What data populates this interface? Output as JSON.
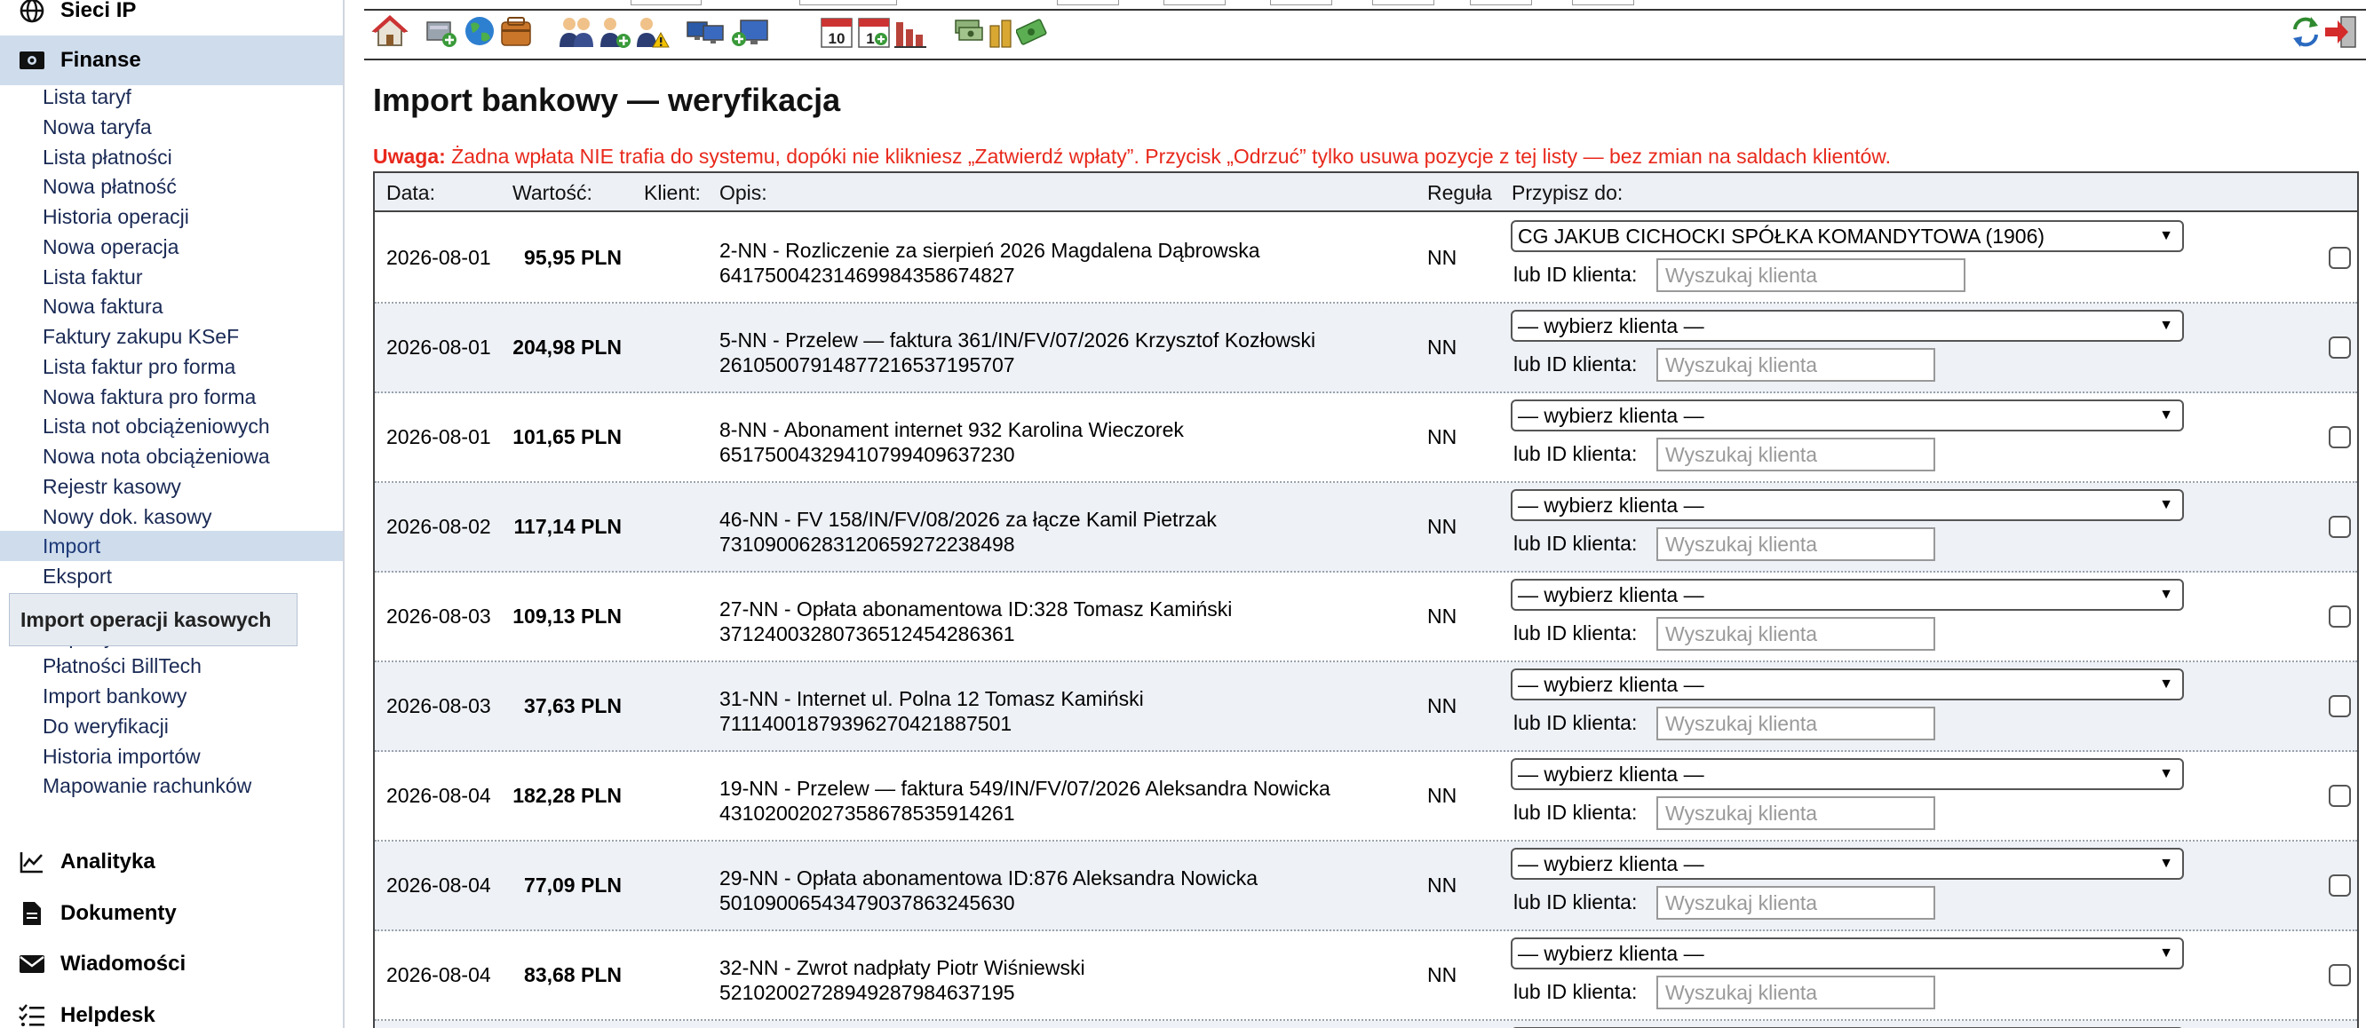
{
  "sidebar": {
    "sections": {
      "sieci": {
        "label": "Sieci IP",
        "icon": "globe-icon"
      },
      "finanse": {
        "label": "Finanse",
        "icon": "money-icon"
      },
      "analityka": {
        "label": "Analityka",
        "icon": "chart-line-icon"
      },
      "dokumenty": {
        "label": "Dokumenty",
        "icon": "document-icon"
      },
      "wiadomosci": {
        "label": "Wiadomości",
        "icon": "envelope-icon"
      },
      "helpdesk": {
        "label": "Helpdesk",
        "icon": "checklist-icon"
      }
    },
    "finanse_items": [
      "Lista taryf",
      "Nowa taryfa",
      "Lista płatności",
      "Nowa płatność",
      "Historia operacji",
      "Nowa operacja",
      "Lista faktur",
      "Nowa faktura",
      "Faktury zakupu KSeF",
      "Lista faktur pro forma",
      "Nowa faktura pro forma",
      "Lista not obciążeniowych",
      "Nowa nota obciążeniowa",
      "Rejestr kasowy",
      "Nowy dok. kasowy",
      "Import",
      "Eksport",
      "",
      "Raporty",
      "Płatności BillTech",
      "Import bankowy",
      "Do weryfikacji",
      "Historia importów",
      "Mapowanie rachunków"
    ],
    "active_item": "Import",
    "tooltip": "Import operacji kasowych"
  },
  "toolbar": {
    "icons": [
      "home-icon",
      "network-add-icon",
      "globe-icon",
      "wallet-icon",
      "users-icon",
      "user-add-icon",
      "user-warning-icon",
      "computers-icon",
      "computer-add-icon",
      "calendar-10-icon",
      "calendar-add-icon",
      "bar-chart-icon",
      "money-stack-icon",
      "coins-icon",
      "money-add-icon",
      "refresh-icon",
      "logout-icon"
    ]
  },
  "page": {
    "title": "Import bankowy — weryfikacja",
    "warning_label": "Uwaga:",
    "warning_text": " Żadna wpłata NIE trafia do systemu, dopóki nie klikniesz „Zatwierdź wpłaty”. Przycisk „Odrzuć” tylko usuwa pozycje z tej listy — bez zmian na saldach klientów."
  },
  "table": {
    "headers": {
      "date": "Data:",
      "value": "Wartość:",
      "client": "Klient:",
      "desc": "Opis:",
      "rule": "Reguła",
      "assign": "Przypisz do:"
    },
    "lub_label": "lub ID klienta:",
    "search_placeholder": "Wyszukaj klienta",
    "default_select": "— wybierz klienta —",
    "rows": [
      {
        "date": "2026-08-01",
        "value": "95,95 PLN",
        "desc1": "2-NN - Rozliczenie za sierpień 2026 Magdalena Dąbrowska",
        "desc2": "64175004231469984358674827",
        "rule": "NN",
        "select": "CG JAKUB CICHOCKI SPÓŁKA KOMANDYTOWA (1906)"
      },
      {
        "date": "2026-08-01",
        "value": "204,98 PLN",
        "desc1": "5-NN - Przelew — faktura 361/IN/FV/07/2026 Krzysztof Kozłowski",
        "desc2": "26105007914877216537195707",
        "rule": "NN",
        "select": "— wybierz klienta —"
      },
      {
        "date": "2026-08-01",
        "value": "101,65 PLN",
        "desc1": "8-NN - Abonament internet 932 Karolina Wieczorek",
        "desc2": "65175004329410799409637230",
        "rule": "NN",
        "select": "— wybierz klienta —"
      },
      {
        "date": "2026-08-02",
        "value": "117,14 PLN",
        "desc1": "46-NN - FV 158/IN/FV/08/2026 za łącze Kamil Pietrzak",
        "desc2": "73109006283120659272238498",
        "rule": "NN",
        "select": "— wybierz klienta —"
      },
      {
        "date": "2026-08-03",
        "value": "109,13 PLN",
        "desc1": "27-NN - Opłata abonamentowa ID:328 Tomasz Kamiński",
        "desc2": "37124003280736512454286361",
        "rule": "NN",
        "select": "— wybierz klienta —"
      },
      {
        "date": "2026-08-03",
        "value": "37,63 PLN",
        "desc1": "31-NN - Internet ul. Polna 12 Tomasz Kamiński",
        "desc2": "71114001879396270421887501",
        "rule": "NN",
        "select": "— wybierz klienta —"
      },
      {
        "date": "2026-08-04",
        "value": "182,28 PLN",
        "desc1": "19-NN - Przelew — faktura 549/IN/FV/07/2026 Aleksandra Nowicka",
        "desc2": "43102002027358678535914261",
        "rule": "NN",
        "select": "— wybierz klienta —"
      },
      {
        "date": "2026-08-04",
        "value": "77,09 PLN",
        "desc1": "29-NN - Opłata abonamentowa ID:876 Aleksandra Nowicka",
        "desc2": "50109006543479037863245630",
        "rule": "NN",
        "select": "— wybierz klienta —"
      },
      {
        "date": "2026-08-04",
        "value": "83,68 PLN",
        "desc1": "32-NN - Zwrot nadpłaty Piotr Wiśniewski",
        "desc2": "52102002728949287984637195",
        "rule": "NN",
        "select": "— wybierz klienta —"
      }
    ]
  }
}
